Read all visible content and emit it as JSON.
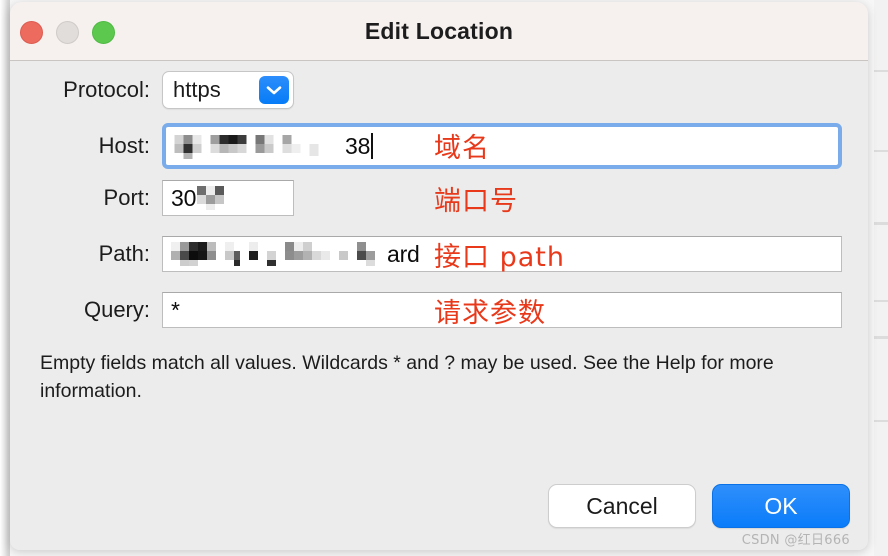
{
  "window": {
    "title": "Edit Location",
    "traffic_lights": [
      {
        "name": "close",
        "color": "#ec6a5e"
      },
      {
        "name": "minimize",
        "color": "#e0dddb"
      },
      {
        "name": "maximize",
        "color": "#5cc94e"
      }
    ]
  },
  "form": {
    "rows": [
      {
        "label": "Protocol:",
        "type": "select",
        "value": "https",
        "redacted": false,
        "annotation": ""
      },
      {
        "label": "Host:",
        "type": "text",
        "value": "38",
        "redacted": true,
        "focused": true,
        "annotation": "域名"
      },
      {
        "label": "Port:",
        "type": "text",
        "value": "30",
        "redacted": true,
        "focused": false,
        "annotation": "端口号"
      },
      {
        "label": "Path:",
        "type": "text",
        "value": "ard",
        "redacted": true,
        "focused": false,
        "annotation": "接口 path"
      },
      {
        "label": "Query:",
        "type": "text",
        "value": "*",
        "redacted": false,
        "focused": false,
        "annotation": "请求参数"
      }
    ]
  },
  "help": {
    "text": "Empty fields match all values. Wildcards * and ? may be used. See the Help for more information."
  },
  "footer": {
    "cancel_label": "Cancel",
    "ok_label": "OK"
  },
  "watermark": {
    "text": "CSDN @红日666"
  },
  "colors": {
    "accent_blue": "#0a7cfa",
    "focus_ring": "#7aaceb",
    "annotation_red": "#e8391b",
    "titlebar_bg": "#f6f1ef",
    "body_bg": "#ececec"
  }
}
